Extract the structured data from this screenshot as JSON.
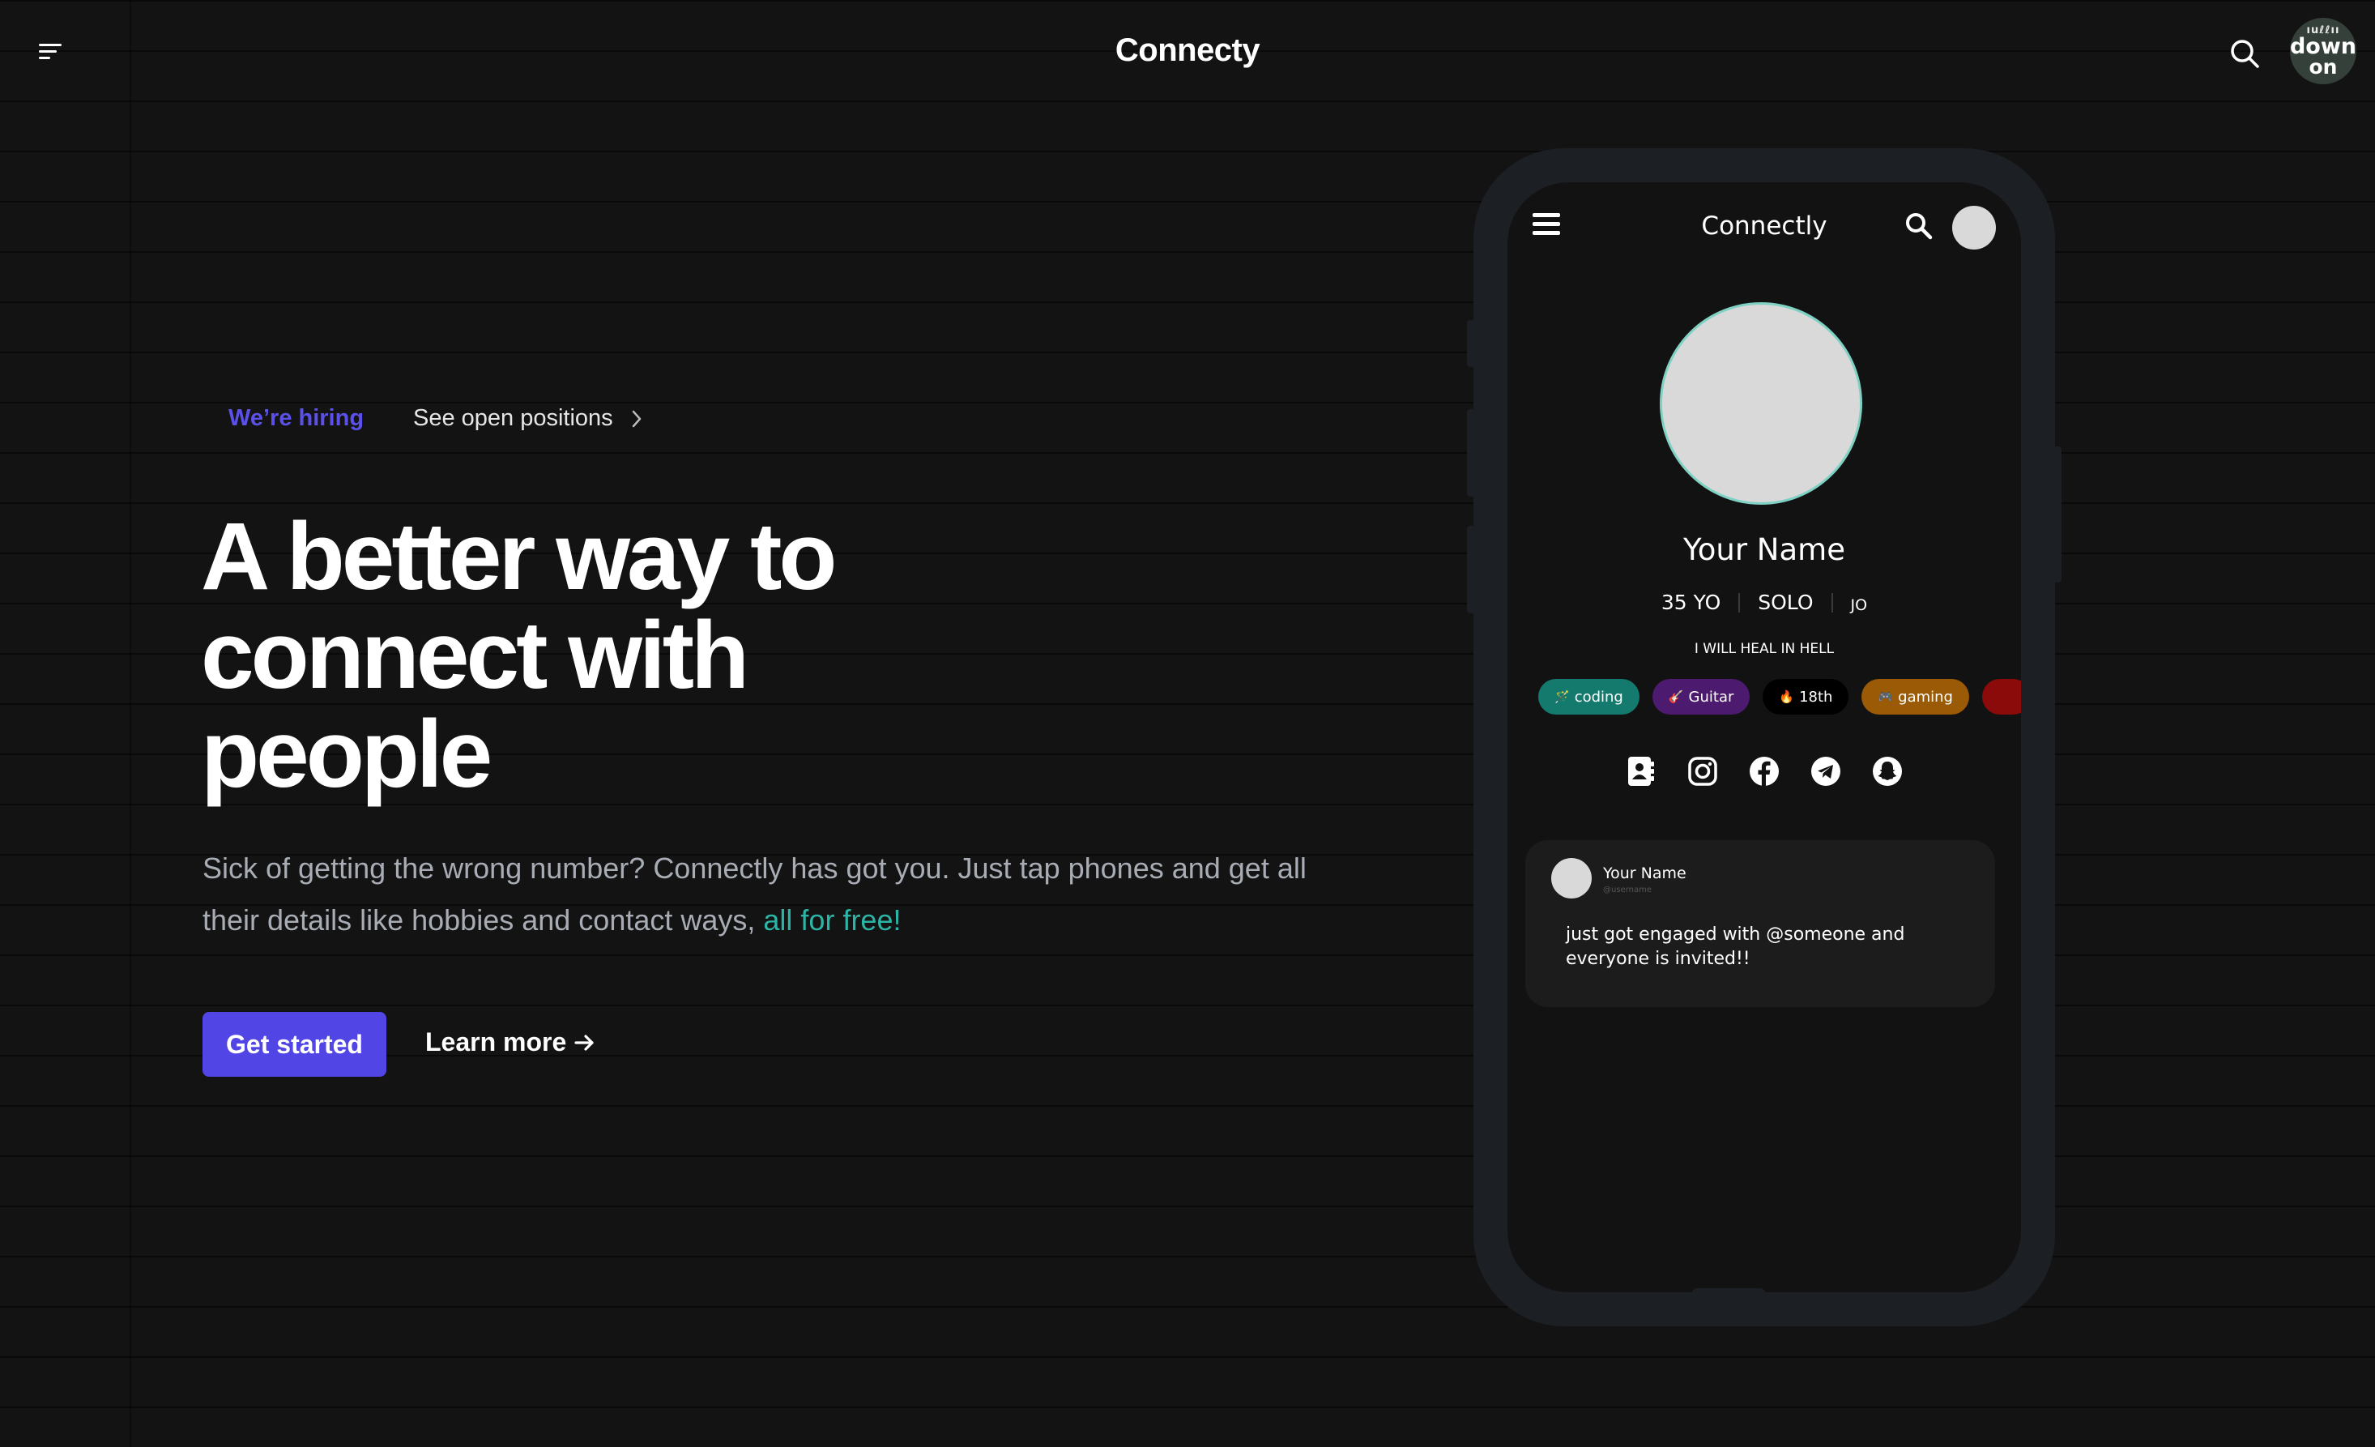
{
  "header": {
    "brand": "Connecty",
    "avatar_lines": [
      "ıuℓℓıı",
      "down",
      "on"
    ]
  },
  "hero": {
    "hiring_label": "We’re hiring",
    "positions_label": "See open positions",
    "headline_lines": [
      "A better way to",
      "connect with",
      "people"
    ],
    "subtext_main": "Sick of getting the wrong number? Connectly has got you. Just tap phones and get all their details like hobbies and contact ways,",
    "subtext_highlight": "all for free!",
    "primary_button": "Get started",
    "secondary_link": "Learn more",
    "colors": {
      "accent": "#5145e5",
      "highlight": "#2bb5a6",
      "hiring": "#5b50e8"
    }
  },
  "phone": {
    "title": "Connectly",
    "profile": {
      "name": "Your Name",
      "age": "35 YO",
      "status": "SOLO",
      "initials": "JO",
      "bio": "I WILL HEAL IN HELL"
    },
    "tags": [
      {
        "icon": "🪄",
        "label": "coding",
        "color": "#147a6e"
      },
      {
        "icon": "🎸",
        "label": "Guitar",
        "color": "#4c1a6e"
      },
      {
        "icon": "🔥",
        "label": "18th",
        "color": "#000000"
      },
      {
        "icon": "🎮",
        "label": "gaming",
        "color": "#9a5a06"
      },
      {
        "icon": "",
        "label": "",
        "color": "#8b0a0a"
      }
    ],
    "socials": [
      "contact-card-icon",
      "instagram-icon",
      "facebook-icon",
      "telegram-icon",
      "snapchat-icon"
    ],
    "post": {
      "name": "Your Name",
      "username": "@username",
      "text": "just got engaged with @someone and everyone is invited!!"
    }
  }
}
